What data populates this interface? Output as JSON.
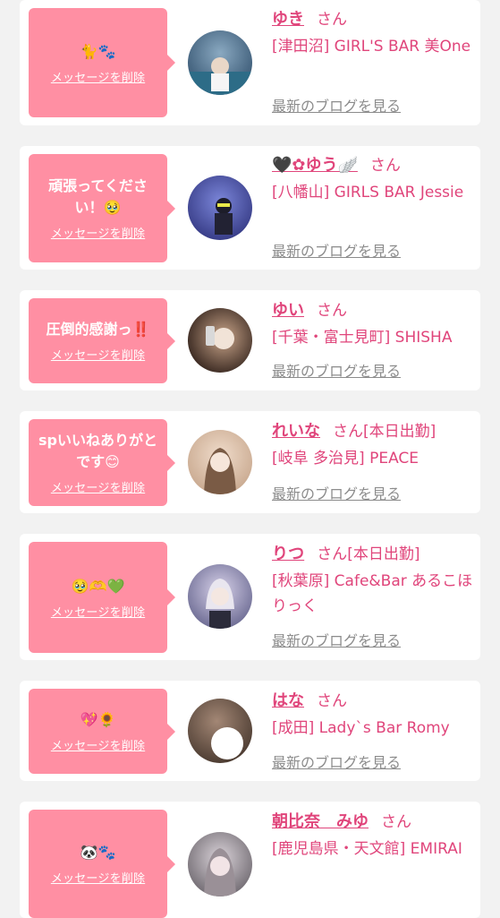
{
  "items": [
    {
      "message": "🐈🐾",
      "delete_label": "メッセージを削除",
      "name": "ゆき",
      "honorific": "さん",
      "status": "",
      "shop": "[津田沼] GIRL'S BAR 美One",
      "blog_label": "最新のブログを見る",
      "avatar_colors": [
        "#3f5e7a",
        "#8aa9c1"
      ]
    },
    {
      "message": "頑張ってください！🥹",
      "delete_label": "メッセージを削除",
      "name": "🖤✿ゆう🪽",
      "honorific": "さん",
      "status": "",
      "shop": "[八幡山] GIRLS BAR Jessie",
      "blog_label": "最新のブログを見る",
      "avatar_colors": [
        "#3a3f8a",
        "#7b86d9"
      ]
    },
    {
      "message": "圧倒的感謝っ‼️",
      "delete_label": "メッセージを削除",
      "name": "ゆい",
      "honorific": "さん",
      "status": "",
      "shop": "[千葉・富士見町] SHISHA",
      "blog_label": "最新のブログを見る",
      "avatar_colors": [
        "#3b2a22",
        "#c9a58a"
      ]
    },
    {
      "message": "spいいねありがとです😊",
      "delete_label": "メッセージを削除",
      "name": "れいな",
      "honorific": "さん",
      "status": "[本日出勤]",
      "shop": "[岐阜 多治見] PEACE",
      "blog_label": "最新のブログを見る",
      "avatar_colors": [
        "#c8a88e",
        "#f0dccb"
      ]
    },
    {
      "message": "🥹🫶💚",
      "delete_label": "メッセージを削除",
      "name": "りつ",
      "honorific": "さん",
      "status": "[本日出勤]",
      "shop": "[秋葉原] Cafe&Bar あるこほりっく",
      "blog_label": "最新のブログを見る",
      "avatar_colors": [
        "#6b6a92",
        "#d7d1e9"
      ]
    },
    {
      "message": "💖🌻",
      "delete_label": "メッセージを削除",
      "name": "はな",
      "honorific": "さん",
      "status": "",
      "shop": "[成田] Lady`s Bar Romy",
      "blog_label": "最新のブログを見る",
      "avatar_colors": [
        "#4a3a30",
        "#a38775"
      ]
    },
    {
      "message": "🐼🐾",
      "delete_label": "メッセージを削除",
      "name": "朝比奈　みゆ",
      "honorific": "さん",
      "status": "",
      "shop": "[鹿児島県・天文館] EMIRAI",
      "blog_label": "最新のブログを見る",
      "avatar_colors": [
        "#6f6970",
        "#d9d2d8"
      ]
    }
  ]
}
